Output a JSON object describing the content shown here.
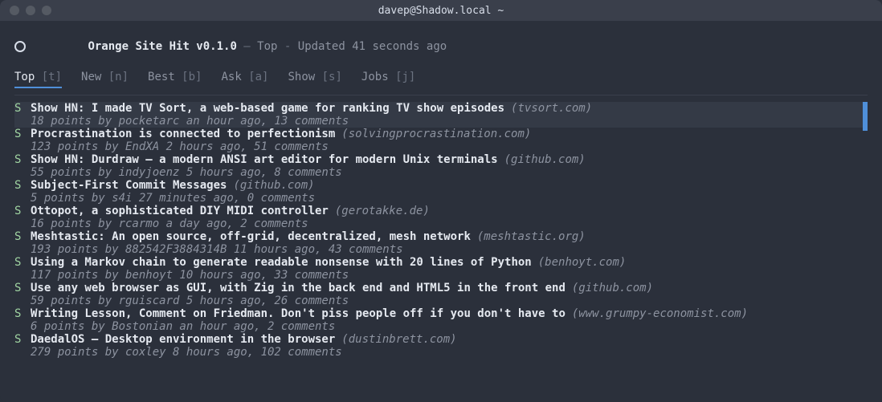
{
  "window": {
    "title": "davep@Shadow.local ~"
  },
  "header": {
    "app_title": "Orange Site Hit v0.1.0",
    "sep1": " — ",
    "section": "Top",
    "sep2": " - ",
    "updated": "Updated 41 seconds ago"
  },
  "tabs": [
    {
      "label": "Top",
      "hotkey": "[t]",
      "active": true
    },
    {
      "label": "New",
      "hotkey": "[n]",
      "active": false
    },
    {
      "label": "Best",
      "hotkey": "[b]",
      "active": false
    },
    {
      "label": "Ask",
      "hotkey": "[a]",
      "active": false
    },
    {
      "label": "Show",
      "hotkey": "[s]",
      "active": false
    },
    {
      "label": "Jobs",
      "hotkey": "[j]",
      "active": false
    }
  ],
  "stories": [
    {
      "prefix": "S",
      "title": "Show HN: I made TV Sort, a web-based game for ranking TV show episodes",
      "domain": "(tvsort.com)",
      "meta": "18 points by pocketarc an hour ago, 13 comments",
      "selected": true
    },
    {
      "prefix": "S",
      "title": "Procrastination is connected to perfectionism",
      "domain": "(solvingprocrastination.com)",
      "meta": "123 points by EndXA 2 hours ago, 51 comments",
      "selected": false
    },
    {
      "prefix": "S",
      "title": "Show HN: Durdraw – a modern ANSI art editor for modern Unix terminals",
      "domain": "(github.com)",
      "meta": "55 points by indyjoenz 5 hours ago, 8 comments",
      "selected": false
    },
    {
      "prefix": "S",
      "title": "Subject-First Commit Messages",
      "domain": "(github.com)",
      "meta": "5 points by s4i 27 minutes ago, 0 comments",
      "selected": false
    },
    {
      "prefix": "S",
      "title": "Ottopot, a sophisticated DIY MIDI controller",
      "domain": "(gerotakke.de)",
      "meta": "16 points by rcarmo a day ago, 2 comments",
      "selected": false
    },
    {
      "prefix": "S",
      "title": "Meshtastic: An open source, off-grid, decentralized, mesh network",
      "domain": "(meshtastic.org)",
      "meta": "193 points by 882542F3884314B 11 hours ago, 43 comments",
      "selected": false
    },
    {
      "prefix": "S",
      "title": "Using a Markov chain to generate readable nonsense with 20 lines of Python",
      "domain": "(benhoyt.com)",
      "meta": "117 points by benhoyt 10 hours ago, 33 comments",
      "selected": false
    },
    {
      "prefix": "S",
      "title": "Use any web browser as GUI, with Zig in the back end and HTML5 in the front end",
      "domain": "(github.com)",
      "meta": "59 points by rguiscard 5 hours ago, 26 comments",
      "selected": false
    },
    {
      "prefix": "S",
      "title": "Writing Lesson, Comment on Friedman. Don't piss people off if you don't have to",
      "domain": "(www.grumpy-economist.com)",
      "meta": "6 points by Bostonian an hour ago, 2 comments",
      "selected": false
    },
    {
      "prefix": "S",
      "title": "DaedalOS – Desktop environment in the browser",
      "domain": "(dustinbrett.com)",
      "meta": "279 points by coxley 8 hours ago, 102 comments",
      "selected": false
    }
  ]
}
